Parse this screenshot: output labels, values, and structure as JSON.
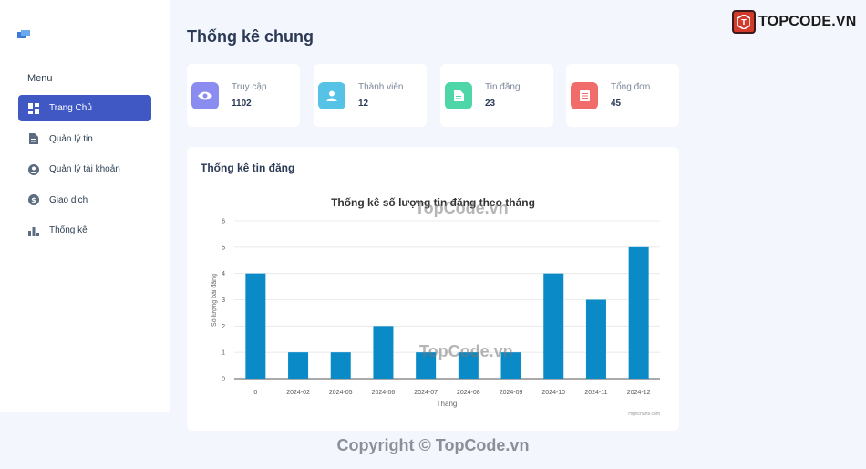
{
  "sidebar": {
    "menu_heading": "Menu",
    "items": [
      {
        "label": "Trang Chủ",
        "icon": "dashboard-icon",
        "active": true
      },
      {
        "label": "Quản lý tin",
        "icon": "document-icon",
        "active": false
      },
      {
        "label": "Quản lý tài khoản",
        "icon": "account-icon",
        "active": false
      },
      {
        "label": "Giao dịch",
        "icon": "dollar-icon",
        "active": false
      },
      {
        "label": "Thống kê",
        "icon": "bar-chart-icon",
        "active": false
      }
    ]
  },
  "page": {
    "title": "Thống kê chung"
  },
  "stats": [
    {
      "label": "Truy cập",
      "value": "1102",
      "icon": "eye-icon",
      "color": "#8b8cf0"
    },
    {
      "label": "Thành viên",
      "value": "12",
      "icon": "user-icon",
      "color": "#56c2e6"
    },
    {
      "label": "Tin đăng",
      "value": "23",
      "icon": "article-icon",
      "color": "#4fd6a8"
    },
    {
      "label": "Tổng đơn",
      "value": "45",
      "icon": "receipt-icon",
      "color": "#f26b6b"
    }
  ],
  "panel": {
    "title": "Thống kê tin đăng"
  },
  "chart_data": {
    "type": "bar",
    "title": "Thống kê số lượng tin đăng theo tháng",
    "xlabel": "Tháng",
    "ylabel": "Số lượng bài đăng",
    "categories": [
      "0",
      "2024-02",
      "2024-05",
      "2024-06",
      "2024-07",
      "2024-08",
      "2024-09",
      "2024-10",
      "2024-11",
      "2024-12"
    ],
    "values": [
      4,
      1,
      1,
      2,
      1,
      1,
      1,
      4,
      3,
      5
    ],
    "ylim": [
      0,
      6
    ],
    "yticks": [
      "0",
      "1",
      "2",
      "3",
      "4",
      "5",
      "6"
    ],
    "grid": true,
    "bar_color": "#0a8ac6",
    "credit": "Highcharts.com"
  },
  "watermarks": {
    "brand": "TOPCODE.VN",
    "overlay": "TopCode.vn",
    "copyright": "Copyright © TopCode.vn"
  }
}
